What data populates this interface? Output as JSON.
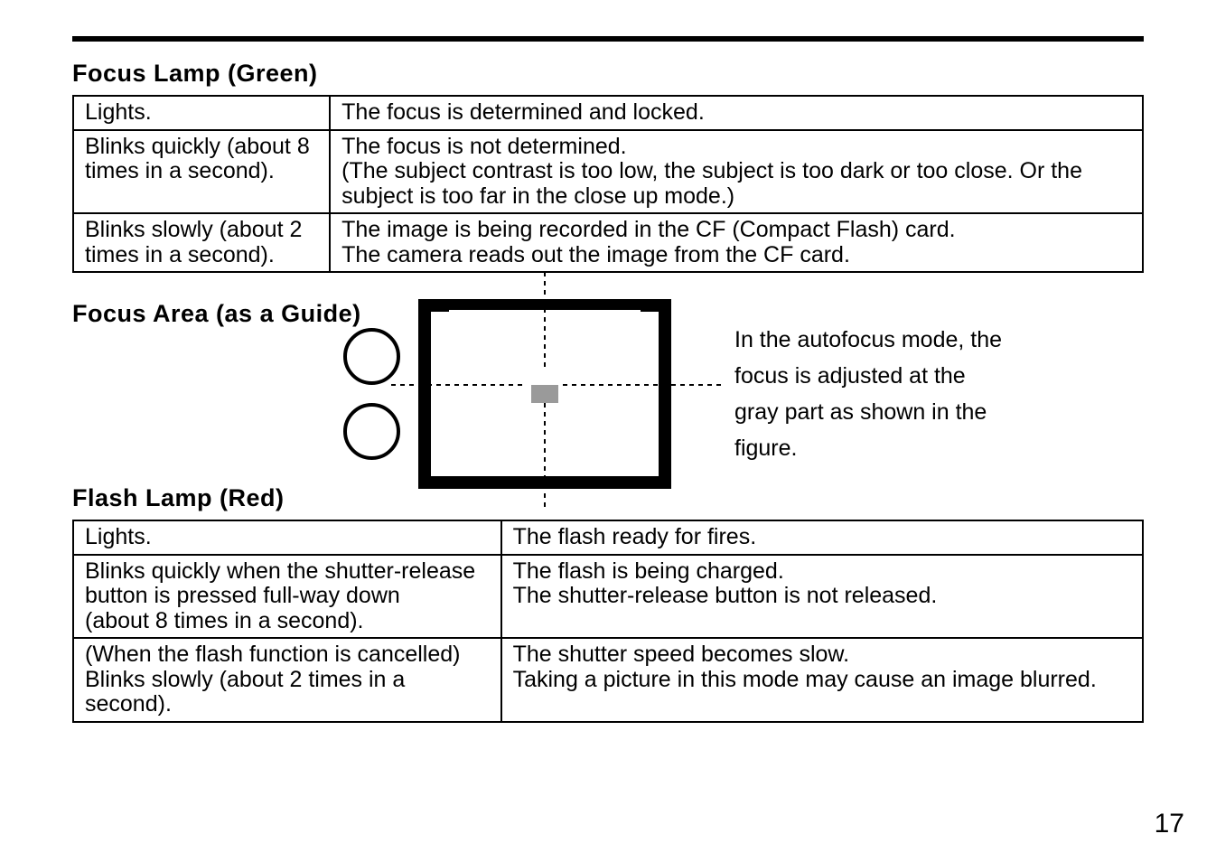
{
  "page_number": "17",
  "sections": {
    "focus_lamp": {
      "title": "Focus Lamp (Green)",
      "rows": [
        {
          "state": "Lights.",
          "meaning": "The focus is determined and locked."
        },
        {
          "state": "Blinks quickly (about 8 times in a second).",
          "meaning": "The focus is not determined.\n(The subject contrast is too low, the subject is too dark or too close. Or the subject is too far in the close up mode.)"
        },
        {
          "state": "Blinks slowly (about 2 times in a second).",
          "meaning": "The image is being recorded in the CF (Compact Flash) card.\nThe camera reads out the image from the CF card."
        }
      ]
    },
    "focus_area": {
      "title": "Focus Area (as a Guide)",
      "caption": "In the autofocus mode, the focus is adjusted at the gray part as shown in the figure."
    },
    "flash_lamp": {
      "title": "Flash Lamp (Red)",
      "rows": [
        {
          "state": "Lights.",
          "meaning": "The flash ready for fires."
        },
        {
          "state": "Blinks quickly when the shutter-release button is pressed full-way down\n(about 8 times in a second).",
          "meaning": "The flash is being charged.\nThe shutter-release button is not released."
        },
        {
          "state": "(When the flash function is cancelled)\nBlinks slowly (about 2 times in a second).",
          "meaning": "The shutter speed becomes slow.\nTaking a picture in this mode may cause an image blurred."
        }
      ]
    }
  }
}
